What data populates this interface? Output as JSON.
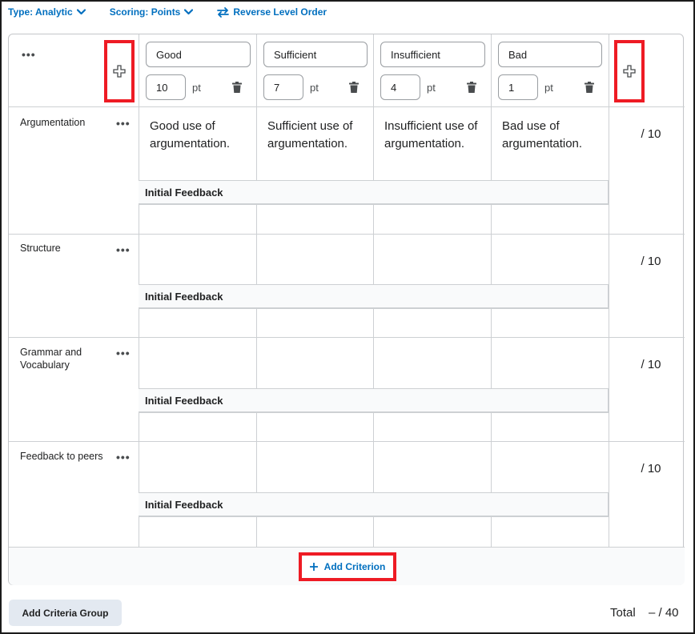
{
  "toolbar": {
    "type_label": "Type: Analytic",
    "scoring_label": "Scoring: Points",
    "reverse_label": "Reverse Level Order"
  },
  "levels": [
    {
      "name": "Good",
      "points": "10"
    },
    {
      "name": "Sufficient",
      "points": "7"
    },
    {
      "name": "Insufficient",
      "points": "4"
    },
    {
      "name": "Bad",
      "points": "1"
    }
  ],
  "pt_unit": "pt",
  "criteria": [
    {
      "name": "Argumentation",
      "descriptions": [
        "Good use of argumentation.",
        "Sufficient use of argumentation.",
        "Insufficient use of argumentation.",
        "Bad use of argumentation."
      ],
      "score": "/ 10"
    },
    {
      "name": "Structure",
      "descriptions": [
        "",
        "",
        "",
        ""
      ],
      "score": "/ 10"
    },
    {
      "name": "Grammar and Vocabulary",
      "descriptions": [
        "",
        "",
        "",
        ""
      ],
      "score": "/ 10"
    },
    {
      "name": "Feedback to peers",
      "descriptions": [
        "",
        "",
        "",
        ""
      ],
      "score": "/ 10"
    }
  ],
  "feedback_label": "Initial Feedback",
  "add_criterion_label": "Add Criterion",
  "add_criteria_group_label": "Add Criteria Group",
  "total": {
    "label": "Total",
    "value": "– / 40"
  },
  "icons": {
    "dropdown": "chevron-down-icon",
    "reverse": "swap-arrows-icon",
    "add": "plus-icon",
    "delete": "trash-icon",
    "more": "more-options-icon"
  },
  "colors": {
    "accent": "#006fbf",
    "highlight": "#ee1b24",
    "border": "#cdd0d3"
  }
}
